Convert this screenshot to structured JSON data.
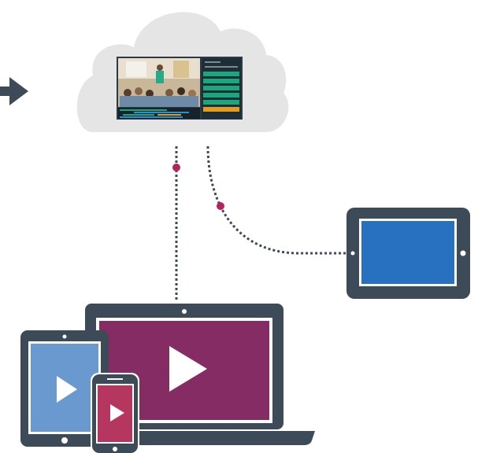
{
  "colors": {
    "device_frame": "#3d4a57",
    "connector_line": "#3d4a57",
    "connector_dot": "#b3245f",
    "cloud_fill": "#e5e5e5",
    "tablet_screen_blue": "#2871c0",
    "laptop_screen_purple": "#862c64",
    "small_tablet_screen": "#6a99cf",
    "phone_screen": "#b5365f",
    "play_icon": "#ffffff",
    "arrow": "#3d4a57",
    "dashboard_panel": "#1f2d37",
    "dashboard_green": "#1aa77c",
    "dashboard_orange": "#e59a21"
  },
  "icons": {
    "incoming_arrow": "arrow-right-icon",
    "cloud": "cloud-icon",
    "play_large": "play-icon",
    "play_tablet": "play-icon",
    "play_phone": "play-icon"
  },
  "devices": [
    "cloud-dashboard",
    "tablet-landscape",
    "laptop",
    "tablet-portrait",
    "smartphone"
  ]
}
